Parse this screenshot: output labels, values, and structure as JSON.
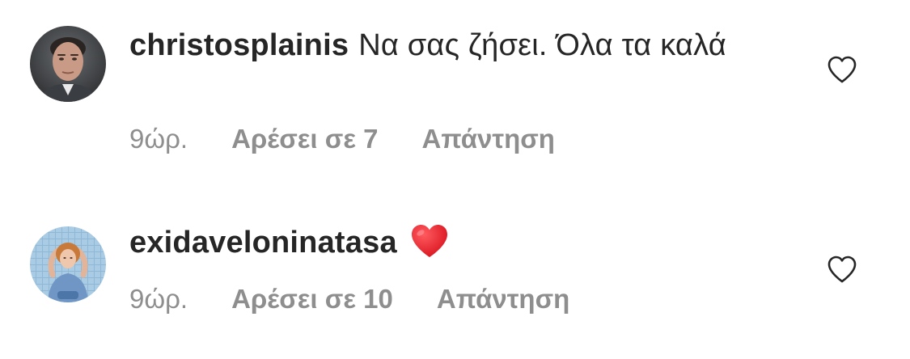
{
  "comments": [
    {
      "username": "christosplainis",
      "text": "Να σας ζήσει. Όλα τα καλά",
      "time": "9ώρ.",
      "likes": "Αρέσει σε 7",
      "reply": "Απάντηση",
      "avatar_icon": "profile-photo",
      "like_icon": "heart-outline-icon"
    },
    {
      "username": "exidaveloninatasa",
      "text": "",
      "emoji": "red-heart-emoji",
      "time": "9ώρ.",
      "likes": "Αρέσει σε 10",
      "reply": "Απάντηση",
      "avatar_icon": "profile-photo",
      "like_icon": "heart-outline-icon"
    }
  ],
  "colors": {
    "text": "#262626",
    "meta": "#8e8e8e",
    "heart": "#e8202d"
  }
}
